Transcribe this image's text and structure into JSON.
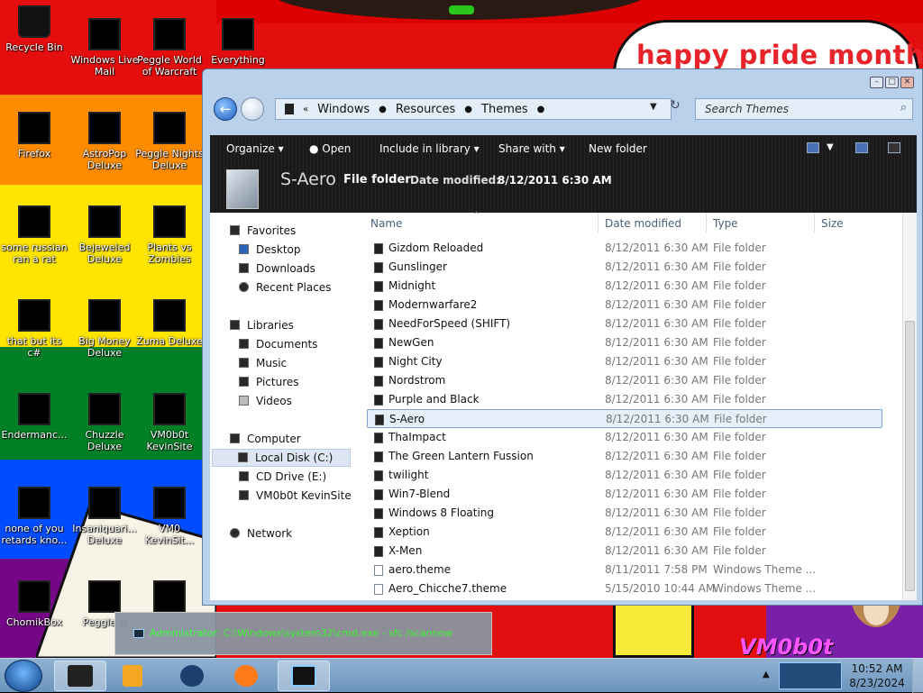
{
  "desktop": {
    "banner_text": "happy pride month",
    "brand_text": "VM0b0t",
    "icons": [
      {
        "label": "Recycle Bin"
      },
      {
        "label": "Windows Live Mail"
      },
      {
        "label": "Peggle World of Warcraft"
      },
      {
        "label": "Everything"
      },
      {
        "label": "Firefox"
      },
      {
        "label": "AstroPop Deluxe"
      },
      {
        "label": "Peggle Nights Deluxe"
      },
      {
        "label": "some russian ran a rat"
      },
      {
        "label": "Bejeweled Deluxe"
      },
      {
        "label": "Plants vs Zombies"
      },
      {
        "label": "that but its c#"
      },
      {
        "label": "Big Money Deluxe"
      },
      {
        "label": "Zuma Deluxe"
      },
      {
        "label": "Endermanc..."
      },
      {
        "label": "Chuzzle Deluxe"
      },
      {
        "label": "VM0b0t KevinSite"
      },
      {
        "label": "none of you retards kno..."
      },
      {
        "label": "Insaniquari... Deluxe"
      },
      {
        "label": "VM0 KevinSit..."
      },
      {
        "label": "ChomikBox"
      },
      {
        "label": "Peggle D"
      }
    ]
  },
  "explorer": {
    "breadcrumb": [
      "Windows",
      "Resources",
      "Themes"
    ],
    "search_placeholder": "Search Themes",
    "toolbar": {
      "organize": "Organize",
      "open": "Open",
      "include": "Include in library",
      "share": "Share with",
      "new_folder": "New folder"
    },
    "details": {
      "name": "S-Aero",
      "type": "File folder",
      "modified_label": "Date modified:",
      "modified_value": "8/12/2011 6:30 AM"
    },
    "nav": {
      "favorites": "Favorites",
      "desktop": "Desktop",
      "downloads": "Downloads",
      "recent": "Recent Places",
      "libraries": "Libraries",
      "documents": "Documents",
      "music": "Music",
      "pictures": "Pictures",
      "videos": "Videos",
      "computer": "Computer",
      "local_disk": "Local Disk (C:)",
      "cd_drive": "CD Drive (E:)",
      "vm_site": "VM0b0t KevinSite",
      "network": "Network"
    },
    "columns": {
      "name": "Name",
      "date": "Date modified",
      "type": "Type",
      "size": "Size"
    },
    "files": [
      {
        "name": "Gizdom Reloaded",
        "date": "8/12/2011 6:30 AM",
        "type": "File folder"
      },
      {
        "name": "Gunslinger",
        "date": "8/12/2011 6:30 AM",
        "type": "File folder"
      },
      {
        "name": "Midnight",
        "date": "8/12/2011 6:30 AM",
        "type": "File folder"
      },
      {
        "name": "Modernwarfare2",
        "date": "8/12/2011 6:30 AM",
        "type": "File folder"
      },
      {
        "name": "NeedForSpeed (SHIFT)",
        "date": "8/12/2011 6:30 AM",
        "type": "File folder"
      },
      {
        "name": "NewGen",
        "date": "8/12/2011 6:30 AM",
        "type": "File folder"
      },
      {
        "name": "Night City",
        "date": "8/12/2011 6:30 AM",
        "type": "File folder"
      },
      {
        "name": "Nordstrom",
        "date": "8/12/2011 6:30 AM",
        "type": "File folder"
      },
      {
        "name": "Purple and Black",
        "date": "8/12/2011 6:30 AM",
        "type": "File folder"
      },
      {
        "name": "S-Aero",
        "date": "8/12/2011 6:30 AM",
        "type": "File folder"
      },
      {
        "name": "ThaImpact",
        "date": "8/12/2011 6:30 AM",
        "type": "File folder"
      },
      {
        "name": "The Green Lantern Fussion",
        "date": "8/12/2011 6:30 AM",
        "type": "File folder"
      },
      {
        "name": "twilight",
        "date": "8/12/2011 6:30 AM",
        "type": "File folder"
      },
      {
        "name": "Win7-Blend",
        "date": "8/12/2011 6:30 AM",
        "type": "File folder"
      },
      {
        "name": "Windows 8 Floating",
        "date": "8/12/2011 6:30 AM",
        "type": "File folder"
      },
      {
        "name": "Xeption",
        "date": "8/12/2011 6:30 AM",
        "type": "File folder"
      },
      {
        "name": "X-Men",
        "date": "8/12/2011 6:30 AM",
        "type": "File folder"
      },
      {
        "name": "aero.theme",
        "date": "8/11/2011 7:58 PM",
        "type": "Windows Theme ..."
      },
      {
        "name": "Aero_Chicche7.theme",
        "date": "5/15/2010 10:44 AM",
        "type": "Windows Theme ..."
      }
    ]
  },
  "cmd_window": {
    "title": "Administrator: C:\\Windows\\system32\\cmd.exe - sfc /scannow"
  },
  "taskbar": {
    "time": "10:52 AM",
    "date": "8/23/2024"
  }
}
